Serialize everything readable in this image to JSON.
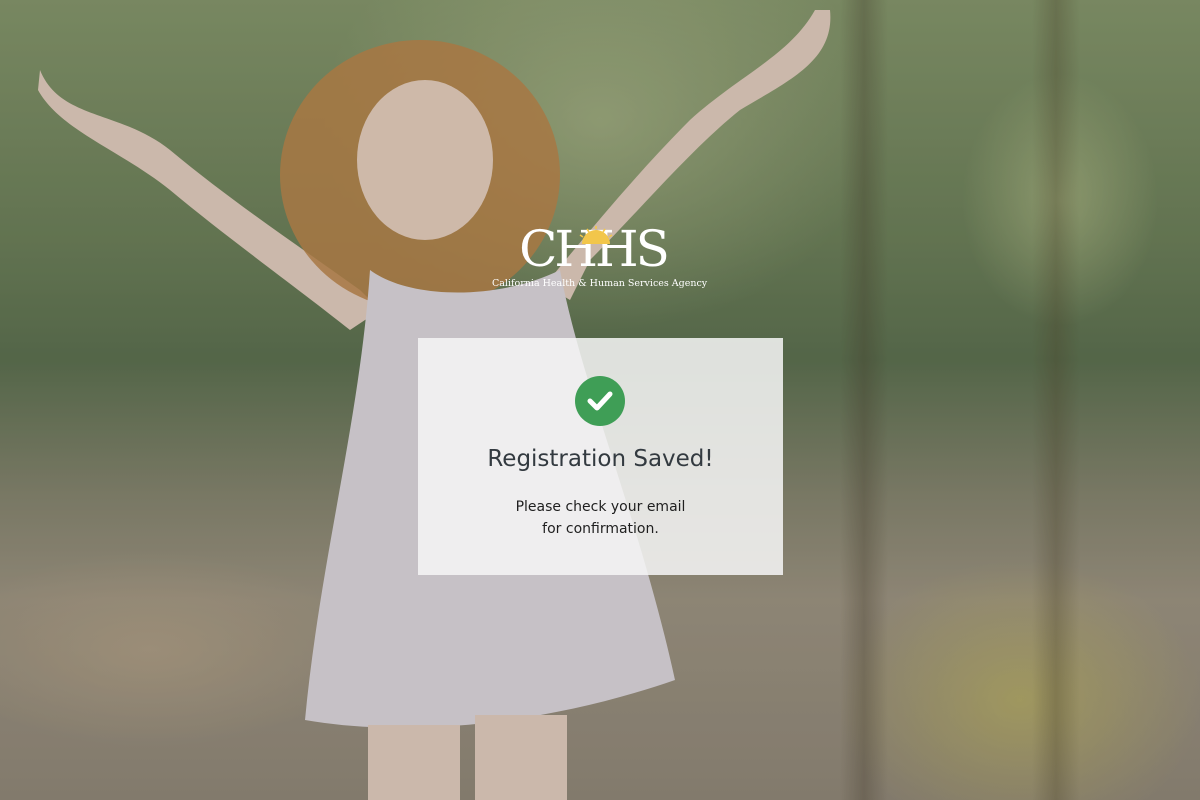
{
  "logo": {
    "mark": "CHHS",
    "subtitle": "California Health & Human Services Agency"
  },
  "confirmation": {
    "icon": "check-circle-icon",
    "title": "Registration Saved!",
    "message_line1": "Please check your email",
    "message_line2": "for confirmation."
  },
  "colors": {
    "check_green": "#3f9e56",
    "card_bg": "#f6f6f6",
    "title_text": "#333a40"
  }
}
